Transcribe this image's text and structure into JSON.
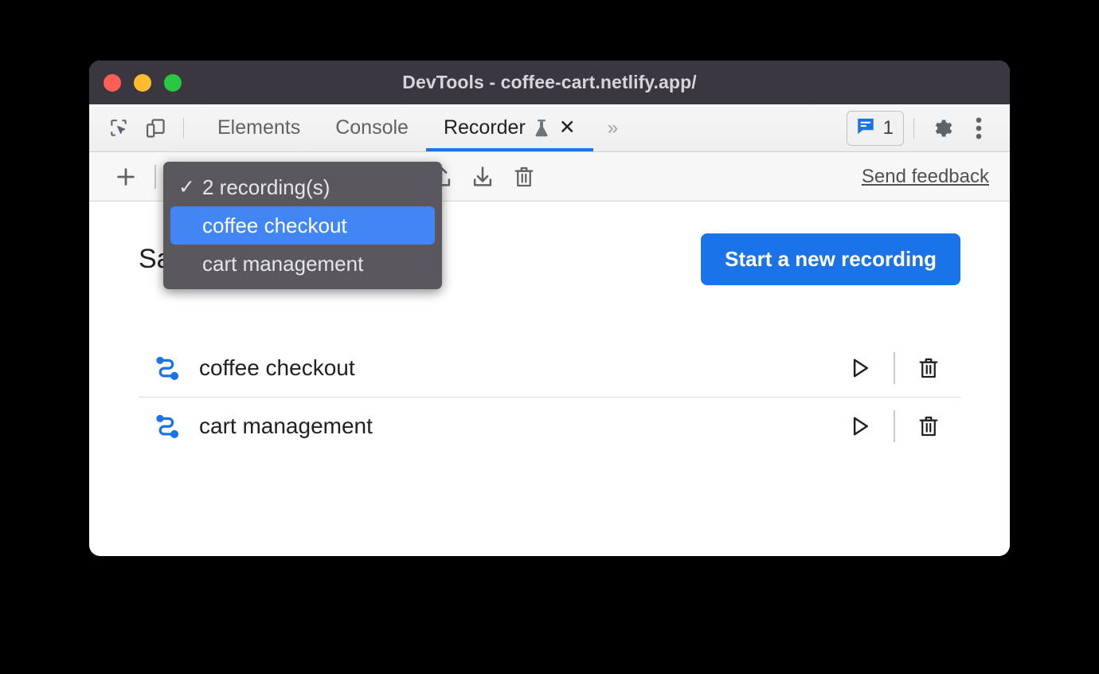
{
  "window": {
    "title": "DevTools - coffee-cart.netlify.app/",
    "traffic_lights": [
      "close",
      "minimize",
      "zoom"
    ],
    "colors": {
      "titlebar_bg": "#3b3740",
      "accent_blue": "#1a73e8",
      "menu_bg": "#5a585e",
      "menu_selected_bg": "#4285f4",
      "light_red": "#ff5f57",
      "light_yellow": "#febc2e",
      "light_green": "#28c840"
    }
  },
  "tabbar": {
    "left_icons": [
      {
        "name": "inspect-element-icon",
        "label": "Inspect element"
      },
      {
        "name": "device-toolbar-icon",
        "label": "Toggle device toolbar"
      }
    ],
    "tabs": [
      {
        "label": "Elements",
        "active": false
      },
      {
        "label": "Console",
        "active": false
      },
      {
        "label": "Recorder",
        "active": true,
        "experimental": true,
        "closable": true
      }
    ],
    "close_glyph": "✕",
    "more_tabs_glyph": "»",
    "issues": {
      "icon": "issues-icon",
      "count": "1"
    },
    "settings_icon": "gear-icon",
    "more_options_icon": "kebab-menu-icon"
  },
  "recorder_toolbar": {
    "add_label": "+",
    "selected_recording": "coffee checkout",
    "export_label": "Export",
    "import_label": "Import",
    "delete_label": "Delete",
    "send_feedback": "Send feedback"
  },
  "dropdown": {
    "open": true,
    "check_glyph": "✓",
    "items": [
      {
        "label": "2 recording(s)",
        "checked": true,
        "selected": false
      },
      {
        "label": "coffee checkout",
        "checked": false,
        "selected": true
      },
      {
        "label": "cart management",
        "checked": false,
        "selected": false
      }
    ]
  },
  "panel": {
    "title": "Saved recordings",
    "new_recording_button": "Start a new recording",
    "recordings": [
      {
        "name": "coffee checkout",
        "icon": "recording-flow-icon",
        "replay": "Replay",
        "delete": "Delete"
      },
      {
        "name": "cart management",
        "icon": "recording-flow-icon",
        "replay": "Replay",
        "delete": "Delete"
      }
    ]
  }
}
